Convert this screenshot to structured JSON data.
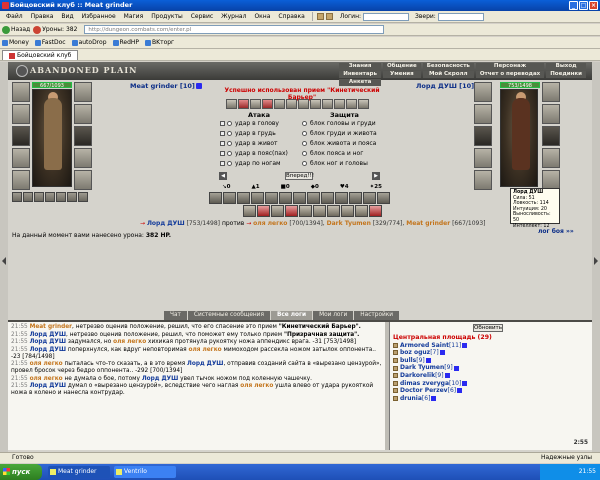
{
  "window": {
    "title": "Бойцовский клуб :: Meat grinder"
  },
  "menu": {
    "items": [
      "Файл",
      "Правка",
      "Вид",
      "Избранное",
      "Магия",
      "Продукты",
      "Сервис",
      "Журнал",
      "Окна",
      "Справка"
    ],
    "login_label": "Логин:",
    "beasts_label": "Звери:"
  },
  "toolbar": {
    "buttons": [
      "Назад",
      "Уроны: 382"
    ],
    "address": "http://dungeon.combats.com/enter.pl"
  },
  "links": [
    "Money",
    "FastDoc",
    "autoDrop",
    "RedHP",
    "BKторг"
  ],
  "tab": {
    "label": "Бойцовский клуб"
  },
  "banner": {
    "logo": "ABANDONED PLAIN",
    "menu": [
      "Знания",
      "Общение",
      "Безопасность",
      "Персонаж",
      "Выход",
      "Инвентарь",
      "Умения",
      "Мой Скролл",
      "Отчет о переводах",
      "Поединки",
      "Анкета"
    ]
  },
  "left_player": {
    "name": "Meat grinder",
    "level": "[10]",
    "hp": "667/1093"
  },
  "right_player": {
    "name": "Лорд ДУШ",
    "level": "[10]",
    "hp": "753/1498"
  },
  "center": {
    "success": "Успешно использован прием \"Кинетический Барьер\"",
    "attack_title": "Атака",
    "defense_title": "Защита",
    "attacks": [
      "удар в голову",
      "удар в грудь",
      "удар в живот",
      "удар в пояс(пах)",
      "удар по ногам"
    ],
    "defenses": [
      "блок головы и груди",
      "блок груди и живота",
      "блок живота и пояса",
      "блок пояса и ног",
      "блок ног и головы"
    ],
    "go_button": "Вперед!!!",
    "stats": [
      "0",
      "1",
      "0",
      "0",
      "4",
      "25"
    ]
  },
  "tooltip": {
    "name": "Лорд ДУШ",
    "lines": [
      "Сила: 51",
      "Ловкость: 114",
      "Интуиция: 20",
      "Выносливость: 50",
      "Интеллект: 12"
    ]
  },
  "vs_line": {
    "p1": "Лорд ДУШ",
    "p1_hp": "[753/1498]",
    "vs": "против",
    "p2": "оля легко",
    "p2_hp": "[700/1394],",
    "p3": "Dark Tyumen",
    "p3_hp": "[329/774],",
    "p4": "Meat grinder",
    "p4_hp": "[667/1093]"
  },
  "damage": {
    "text": "На данный момент вами нанесено урона:",
    "value": "382 HP."
  },
  "battle_log_link": "лог боя »»",
  "chat_tabs": [
    "Чат",
    "Системные сообщения",
    "Все логи",
    "Мои логи",
    "Настройки"
  ],
  "chat": [
    {
      "t": "21:55",
      "a": "Meat grinder",
      "text": ", нетрезво оценив положение, решил, что его спасение это прием ",
      "bold": "\"Кинетический Барьер\"."
    },
    {
      "t": "21:55",
      "a": "Лорд ДУШ",
      "text": ", нетрезво оценив положение, решил, что поможет ему только прием ",
      "bold": "\"Призрачная защита\"."
    },
    {
      "t": "21:55",
      "a": "Лорд ДУШ",
      "text": " задумался, но ",
      "b": "оля легко",
      "text2": " хихикая протянула рукоятку ножа аппендикс врага. -31 [753/1498]"
    },
    {
      "t": "21:55",
      "a": "Лорд ДУШ",
      "text": " поперхнулся, как вдруг неповторимая ",
      "b": "оля легко",
      "text2": " мимоходом рассекла ножом затылок оппонента.. -23 [784/1498]"
    },
    {
      "t": "21:55",
      "a": "оля легко",
      "text": " пыталась что-то сказать, а в это время ",
      "b": "Лорд ДУШ",
      "text2": ", отправив созданий сайта в «вырезано цензурой», провел бросок через бедро оппонента.. -292 [700/1394]"
    },
    {
      "t": "21:55",
      "a": "оля легко",
      "text": " не думала о бое, потому ",
      "b": "Лорд ДУШ",
      "text2": " увел тычок ножом под коленную чашечку."
    },
    {
      "t": "21:55",
      "a": "Лорд ДУШ",
      "text": " думал о «вырезано цензурой», вследствие чего наглая ",
      "b": "оля легко",
      "text2": " ушла влево от удара рукояткой ножа в колено и нанесла контрудар."
    }
  ],
  "right_panel": {
    "refresh": "Обновить",
    "room": "Центральная площадь (29)",
    "users": [
      {
        "name": "Armored Saint",
        "lv": "[11]"
      },
      {
        "name": "boz oguz",
        "lv": "[7]"
      },
      {
        "name": "bulls",
        "lv": "[9]"
      },
      {
        "name": "Dark Tyumen",
        "lv": "[9]"
      },
      {
        "name": "Darkorelik",
        "lv": "[9]"
      },
      {
        "name": "dimas zveryga",
        "lv": "[10]"
      },
      {
        "name": "Doctor Perzev",
        "lv": "[6]"
      },
      {
        "name": "drunia",
        "lv": "[6]"
      }
    ],
    "clock": "2:55"
  },
  "status": {
    "left": "Готово",
    "right": "Надежные узлы"
  },
  "taskbar": {
    "start": "пуск",
    "tasks": [
      "Meat grinder",
      "Ventrilo"
    ],
    "time": "21:55"
  }
}
